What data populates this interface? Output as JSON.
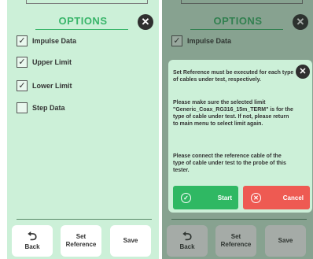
{
  "options_screen": {
    "title": "OPTIONS",
    "close_icon": "close-icon",
    "options": [
      {
        "label": "Impulse Data",
        "checked": true
      },
      {
        "label": "Upper Limit",
        "checked": true
      },
      {
        "label": "Lower Limit",
        "checked": true
      },
      {
        "label": "Step Data",
        "checked": false
      }
    ],
    "buttons": {
      "back": "Back",
      "set_reference": "Set Reference",
      "save": "Save"
    }
  },
  "dialog": {
    "paragraph_1": "Set Reference must be executed for each type of cables under test, respectively.",
    "paragraph_2": "Please make sure the selected limit \"Generic_Coax_RG316_15m_TERM\" is for the type of cable under test. If not, please return to main menu to select limit again.",
    "paragraph_3": "Please connect the reference cable of the type of cable under test to the probe of this tester.",
    "start_label": "Start",
    "cancel_label": "Cancel"
  },
  "colors": {
    "background": "#ccf0d8",
    "accent": "#39b56a",
    "start": "#2fb863",
    "cancel": "#ee5a52"
  }
}
